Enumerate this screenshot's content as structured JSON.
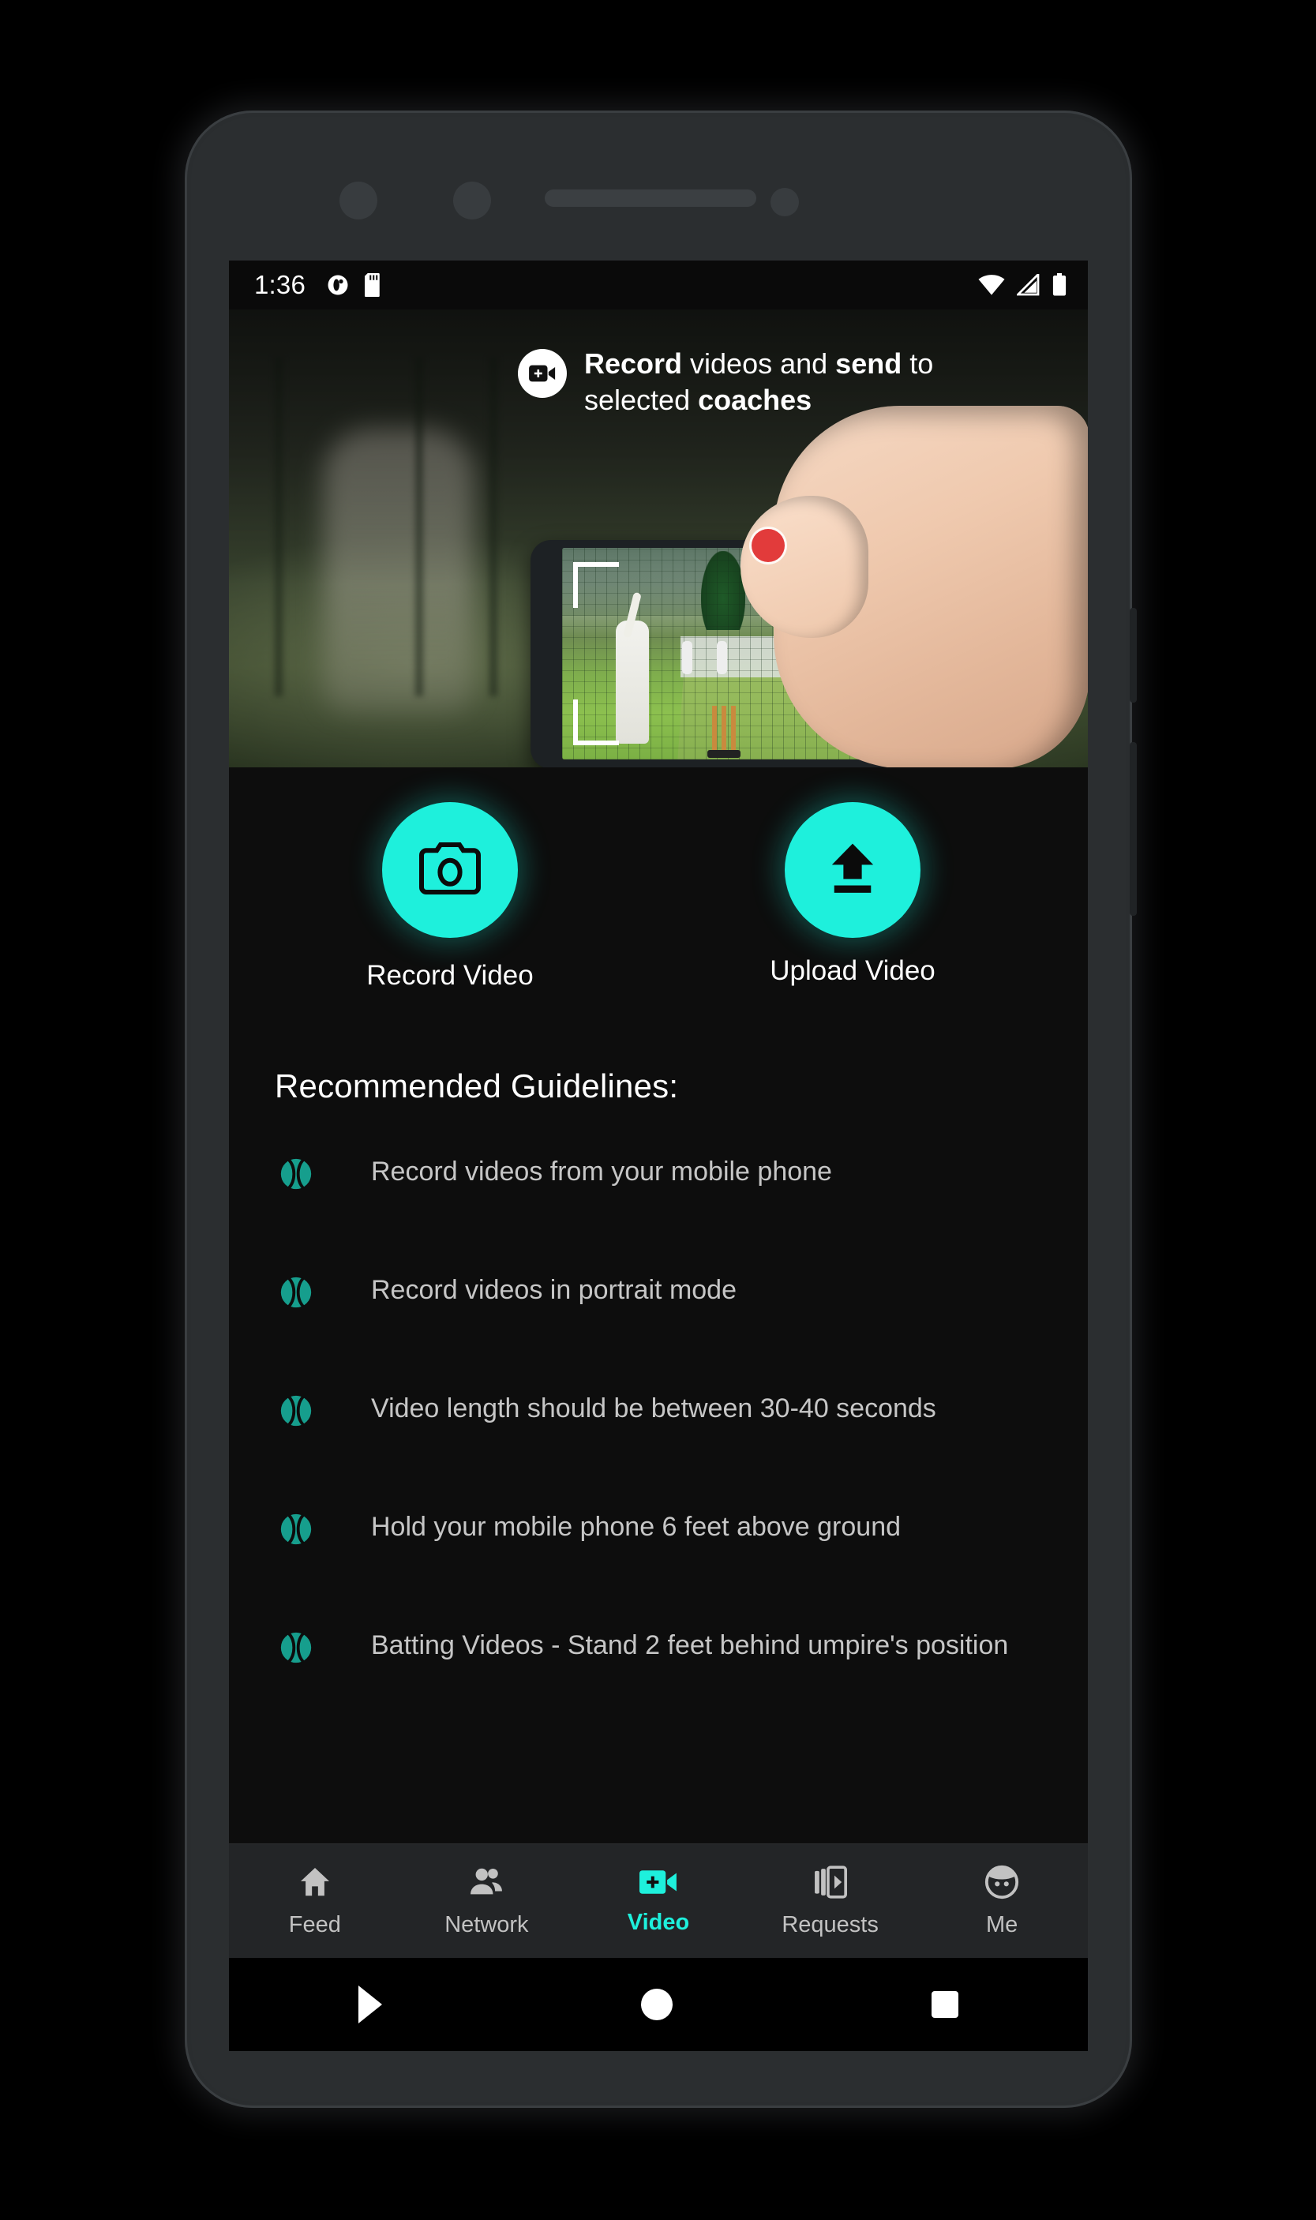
{
  "status_bar": {
    "time": "1:36",
    "left_icons": [
      "app-notification-icon",
      "sd-card-icon"
    ],
    "right_icons": [
      "wifi-icon",
      "cellular-signal-icon",
      "battery-icon"
    ]
  },
  "hero": {
    "icon": "video-add-icon",
    "line1_pre": "Record",
    "line1_mid": " videos and ",
    "line1_bold2": "send",
    "line1_post": " to",
    "line2_pre": "selected ",
    "line2_bold": "coaches",
    "full_text": "Record videos and send to selected coaches"
  },
  "actions": [
    {
      "id": "record-video",
      "label": "Record Video",
      "icon": "camera-icon"
    },
    {
      "id": "upload-video",
      "label": "Upload Video",
      "icon": "upload-icon"
    }
  ],
  "guidelines": {
    "title": "Recommended Guidelines:",
    "items": [
      "Record videos from your mobile phone",
      "Record videos in portrait mode",
      "Video length should be between 30-40 seconds",
      "Hold your mobile phone 6 feet above ground",
      "Batting Videos - Stand 2 feet behind umpire's position"
    ]
  },
  "bottom_nav": {
    "items": [
      {
        "label": "Feed",
        "icon": "home-icon",
        "active": false
      },
      {
        "label": "Network",
        "icon": "people-icon",
        "active": false
      },
      {
        "label": "Video",
        "icon": "video-add-icon",
        "active": true
      },
      {
        "label": "Requests",
        "icon": "video-list-icon",
        "active": false
      },
      {
        "label": "Me",
        "icon": "face-avatar-icon",
        "active": false
      }
    ]
  },
  "system_nav": {
    "back": "back-button",
    "home": "home-button",
    "recents": "recents-button"
  },
  "colors": {
    "accent": "#1ef0dc",
    "ball_teal": "#169e8d",
    "screen_bg": "#0d0d0d",
    "nav_bg": "#232527",
    "text_muted": "#c6c6c6"
  }
}
